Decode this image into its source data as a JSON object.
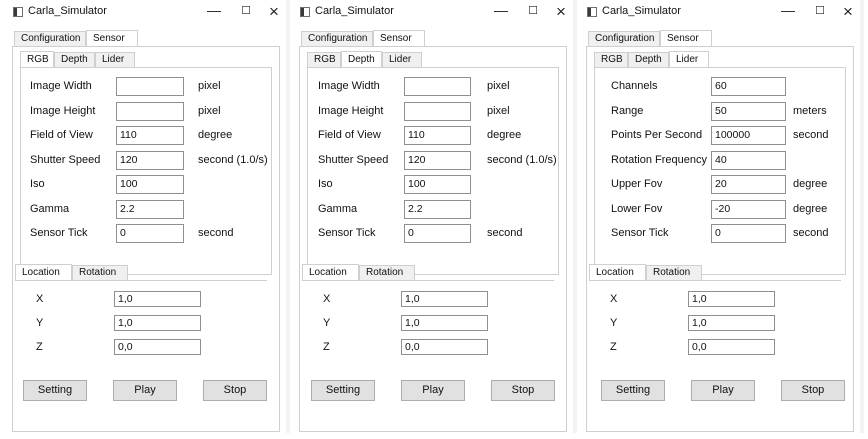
{
  "windows": [
    {
      "title": "Carla_Simulator",
      "main_tabs": [
        "Configuration",
        "Sensor"
      ],
      "sensor_tabs": [
        "RGB",
        "Depth",
        "Lider"
      ],
      "active_sensor_tab": "RGB",
      "fields": [
        {
          "label": "Image Width",
          "value": "",
          "unit": "pixel"
        },
        {
          "label": "Image Height",
          "value": "",
          "unit": "pixel"
        },
        {
          "label": "Field of View",
          "value": "110",
          "unit": "degree"
        },
        {
          "label": "Shutter Speed",
          "value": "120",
          "unit": "second (1.0/s)"
        },
        {
          "label": "Iso",
          "value": "100",
          "unit": ""
        },
        {
          "label": "Gamma",
          "value": "2.2",
          "unit": ""
        },
        {
          "label": "Sensor Tick",
          "value": "0",
          "unit": "second"
        }
      ],
      "loc_tabs": [
        "Location",
        "Rotation"
      ],
      "coords": [
        {
          "label": "X",
          "value": "1,0"
        },
        {
          "label": "Y",
          "value": "1,0"
        },
        {
          "label": "Z",
          "value": "0,0"
        }
      ],
      "buttons": [
        "Setting",
        "Play",
        "Stop"
      ]
    },
    {
      "title": "Carla_Simulator",
      "main_tabs": [
        "Configuration",
        "Sensor"
      ],
      "sensor_tabs": [
        "RGB",
        "Depth",
        "Lider"
      ],
      "active_sensor_tab": "Depth",
      "fields": [
        {
          "label": "Image Width",
          "value": "",
          "unit": "pixel"
        },
        {
          "label": "Image Height",
          "value": "",
          "unit": "pixel"
        },
        {
          "label": "Field of View",
          "value": "110",
          "unit": "degree"
        },
        {
          "label": "Shutter Speed",
          "value": "120",
          "unit": "second (1.0/s)"
        },
        {
          "label": "Iso",
          "value": "100",
          "unit": ""
        },
        {
          "label": "Gamma",
          "value": "2.2",
          "unit": ""
        },
        {
          "label": "Sensor Tick",
          "value": "0",
          "unit": "second"
        }
      ],
      "loc_tabs": [
        "Location",
        "Rotation"
      ],
      "coords": [
        {
          "label": "X",
          "value": "1,0"
        },
        {
          "label": "Y",
          "value": "1,0"
        },
        {
          "label": "Z",
          "value": "0,0"
        }
      ],
      "buttons": [
        "Setting",
        "Play",
        "Stop"
      ]
    },
    {
      "title": "Carla_Simulator",
      "main_tabs": [
        "Configuration",
        "Sensor"
      ],
      "sensor_tabs": [
        "RGB",
        "Depth",
        "Lider"
      ],
      "active_sensor_tab": "Lider",
      "fields": [
        {
          "label": "Channels",
          "value": "60",
          "unit": ""
        },
        {
          "label": "Range",
          "value": "50",
          "unit": "meters"
        },
        {
          "label": "Points Per Second",
          "value": "100000",
          "unit": "second"
        },
        {
          "label": "Rotation Frequency",
          "value": "40",
          "unit": ""
        },
        {
          "label": "Upper Fov",
          "value": "20",
          "unit": "degree"
        },
        {
          "label": "Lower Fov",
          "value": "-20",
          "unit": "degree"
        },
        {
          "label": "Sensor Tick",
          "value": "0",
          "unit": "second"
        }
      ],
      "loc_tabs": [
        "Location",
        "Rotation"
      ],
      "coords": [
        {
          "label": "X",
          "value": "1,0"
        },
        {
          "label": "Y",
          "value": "1,0"
        },
        {
          "label": "Z",
          "value": "0,0"
        }
      ],
      "buttons": [
        "Setting",
        "Play",
        "Stop"
      ]
    }
  ]
}
